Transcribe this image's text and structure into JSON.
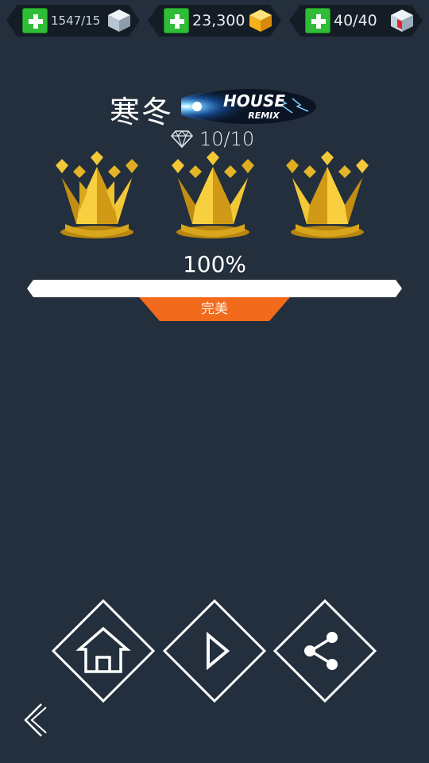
{
  "resources": [
    {
      "value": "1547/15",
      "icon": "ice-cube-icon"
    },
    {
      "value": "23,300",
      "icon": "gold-cube-icon"
    },
    {
      "value": "40/40",
      "icon": "energy-cube-icon"
    }
  ],
  "song": {
    "title": "寒冬",
    "remix_logo_line1": "HOUSE",
    "remix_logo_line2": "REMIX"
  },
  "gems": {
    "count": "10/10",
    "icon": "diamond-outline-icon"
  },
  "crowns": {
    "earned": 3,
    "total": 3
  },
  "progress": {
    "percent_label": "100%",
    "value": 100
  },
  "rating": {
    "label": "完美"
  },
  "buttons": {
    "home": "home-icon",
    "play": "play-icon",
    "share": "share-icon",
    "back": "back-chevron-icon"
  },
  "colors": {
    "background": "#232f3c",
    "accent_orange": "#f26a1b",
    "plus_green": "#2fbd37",
    "crown_gold": "#e8b925"
  }
}
